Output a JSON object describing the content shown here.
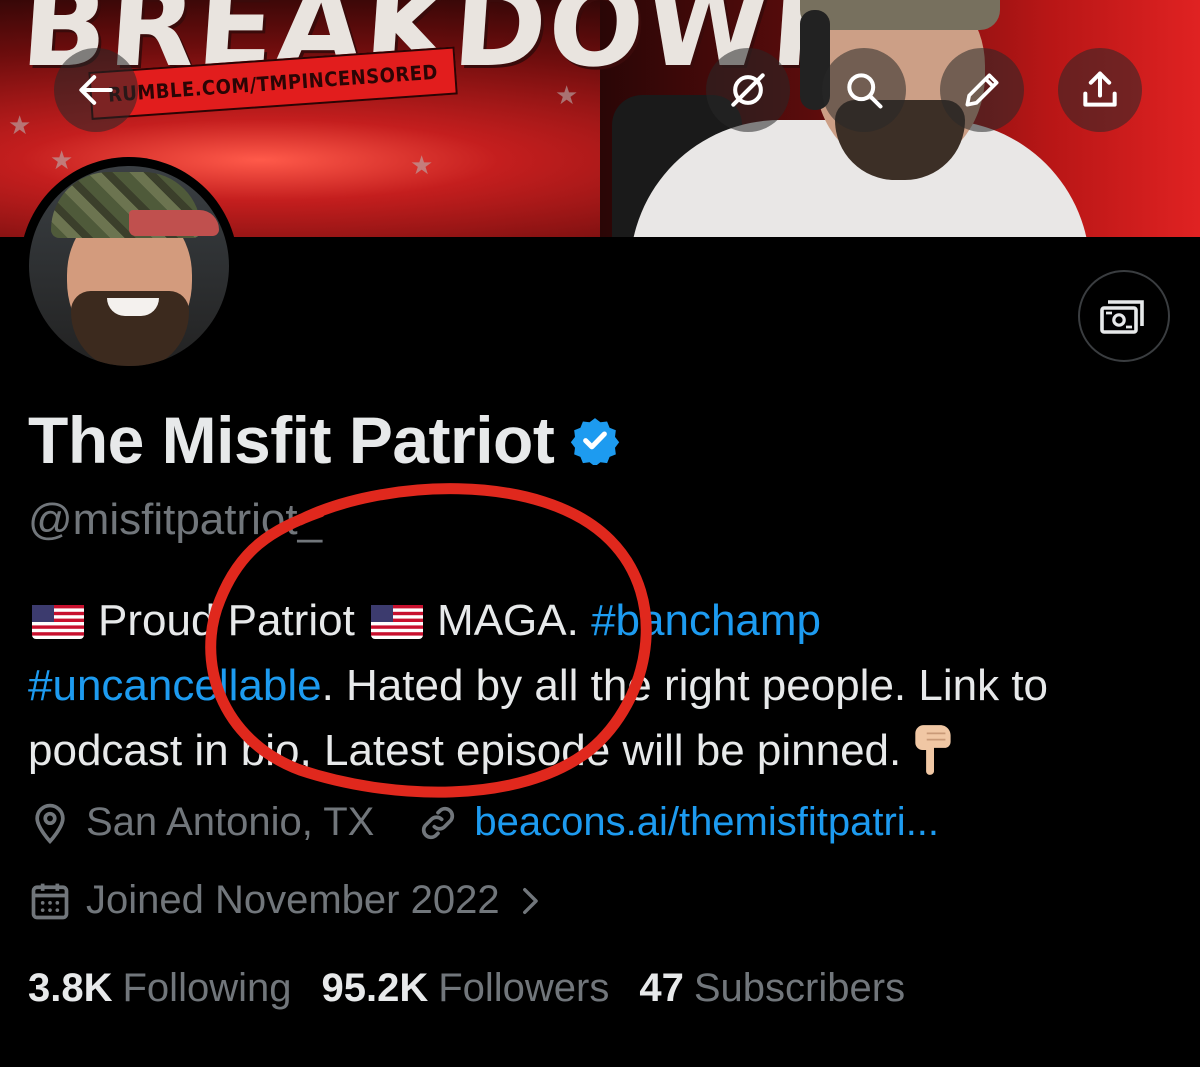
{
  "banner": {
    "title": "BREAKDOWN",
    "url_text": "RUMBLE.COM/TMPINCENSORED"
  },
  "toolbar": {
    "back_icon": "arrow-left-icon",
    "grok_icon": "grok-icon",
    "search_icon": "search-icon",
    "edit_icon": "pencil-icon",
    "share_icon": "share-icon"
  },
  "profile": {
    "display_name": "The Misfit Patriot",
    "handle": "@misfitpatriot_",
    "bio": {
      "part1": "Proud Patriot",
      "part2": "MAGA.",
      "hashtag1": "#banchamp",
      "hashtag2": "#uncancellable",
      "part3": ". Hated by all the right people. Link to podcast in bio, Latest episode will be pinned."
    },
    "location": "San Antonio, TX",
    "website": "beacons.ai/themisfitpatri...",
    "joined": "Joined November 2022"
  },
  "stats": {
    "following_count": "3.8K",
    "following_label": "Following",
    "followers_count": "95.2K",
    "followers_label": "Followers",
    "subscribers_count": "47",
    "subscribers_label": "Subscribers"
  },
  "colors": {
    "background": "#000000",
    "text_primary": "#e7e9ea",
    "text_secondary": "#71767b",
    "link": "#1d9bf0",
    "annotation": "#e0281d"
  }
}
